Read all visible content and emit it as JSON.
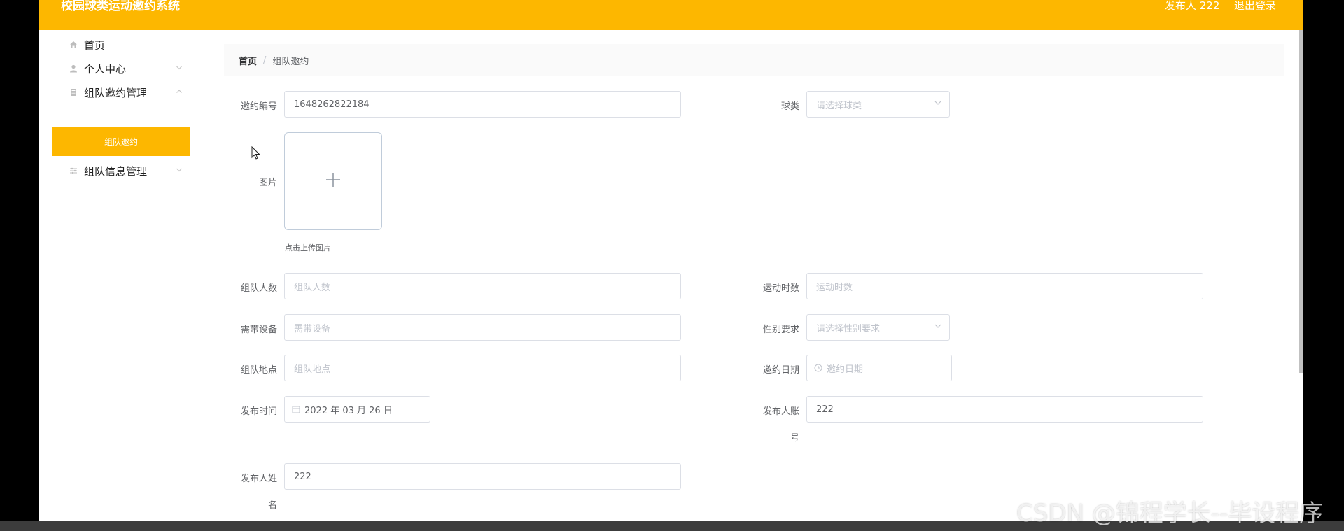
{
  "header": {
    "app_title": "校园球类运动邀约系统",
    "user_text": "发布人 222",
    "logout_label": "退出登录"
  },
  "sidebar": {
    "items": [
      {
        "label": "首页",
        "icon": "home-icon"
      },
      {
        "label": "个人中心",
        "icon": "user-icon"
      },
      {
        "label": "组队邀约管理",
        "icon": "document-icon"
      },
      {
        "label": "组队信息管理",
        "icon": "sliders-icon"
      }
    ],
    "active_subitem": "组队邀约"
  },
  "breadcrumb": {
    "home": "首页",
    "separator": "/",
    "current": "组队邀约"
  },
  "form": {
    "invite_no": {
      "label": "邀约编号",
      "value": "1648262822184"
    },
    "ball_type": {
      "label": "球类",
      "placeholder": "请选择球类"
    },
    "image": {
      "label": "图片",
      "hint": "点击上传图片"
    },
    "team_size": {
      "label": "组队人数",
      "placeholder": "组队人数"
    },
    "sport_hours": {
      "label": "运动时数",
      "placeholder": "运动时数"
    },
    "equipment": {
      "label": "需带设备",
      "placeholder": "需带设备"
    },
    "gender": {
      "label": "性别要求",
      "placeholder": "请选择性别要求"
    },
    "location": {
      "label": "组队地点",
      "placeholder": "组队地点"
    },
    "invite_date": {
      "label": "邀约日期",
      "placeholder": "邀约日期"
    },
    "publish_time": {
      "label": "发布时间",
      "value": "2022 年 03 月 26 日"
    },
    "publisher_account": {
      "label_line1": "发布人账",
      "label_line2": "号",
      "value": "222"
    },
    "publisher_name": {
      "label_line1": "发布人姓",
      "label_line2": "名",
      "value": "222"
    }
  },
  "watermark": "CSDN @锦程学长--毕设程序",
  "colors": {
    "accent": "#fdb700",
    "border": "#dcdfe6",
    "placeholder": "#c0c4cc",
    "label": "#606266"
  }
}
